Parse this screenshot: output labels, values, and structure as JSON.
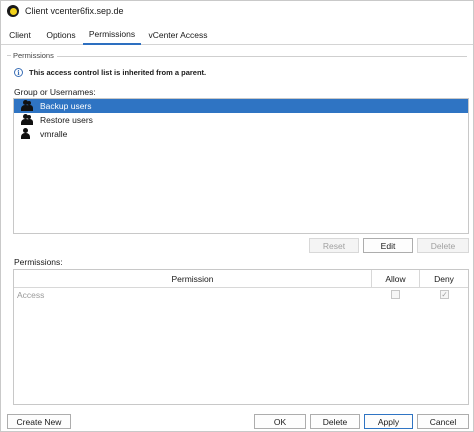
{
  "window": {
    "title": "Client vcenter6fix.sep.de"
  },
  "tabs": [
    {
      "label": "Client",
      "active": false
    },
    {
      "label": "Options",
      "active": false
    },
    {
      "label": "Permissions",
      "active": true
    },
    {
      "label": "vCenter Access",
      "active": false
    }
  ],
  "permissions_group": {
    "title": "Permissions",
    "info_text": "This access control list is inherited from a parent.",
    "group_label": "Group or Usernames:",
    "users": [
      {
        "name": "Backup users",
        "type": "group",
        "selected": true
      },
      {
        "name": "Restore users",
        "type": "group",
        "selected": false
      },
      {
        "name": "vmralle",
        "type": "user",
        "selected": false
      }
    ],
    "list_buttons": {
      "reset": {
        "label": "Reset",
        "enabled": false
      },
      "edit": {
        "label": "Edit",
        "enabled": true
      },
      "delete": {
        "label": "Delete",
        "enabled": false
      }
    },
    "permissions_label": "Permissions:",
    "table": {
      "columns": [
        "Permission",
        "Allow",
        "Deny"
      ],
      "rows": [
        {
          "permission": "Access",
          "allow": false,
          "deny": true,
          "enabled": false
        }
      ]
    }
  },
  "footer": {
    "create_new": "Create New",
    "ok": "OK",
    "delete": "Delete",
    "apply": "Apply",
    "cancel": "Cancel"
  },
  "colors": {
    "accent": "#2f74c3",
    "selection": "#2f74c3",
    "app_icon": "#f2d21b"
  },
  "icons": {
    "app": "sesam-logo-icon",
    "info": "info-icon",
    "group": "user-group-icon",
    "user": "user-icon",
    "check": "check-icon"
  }
}
